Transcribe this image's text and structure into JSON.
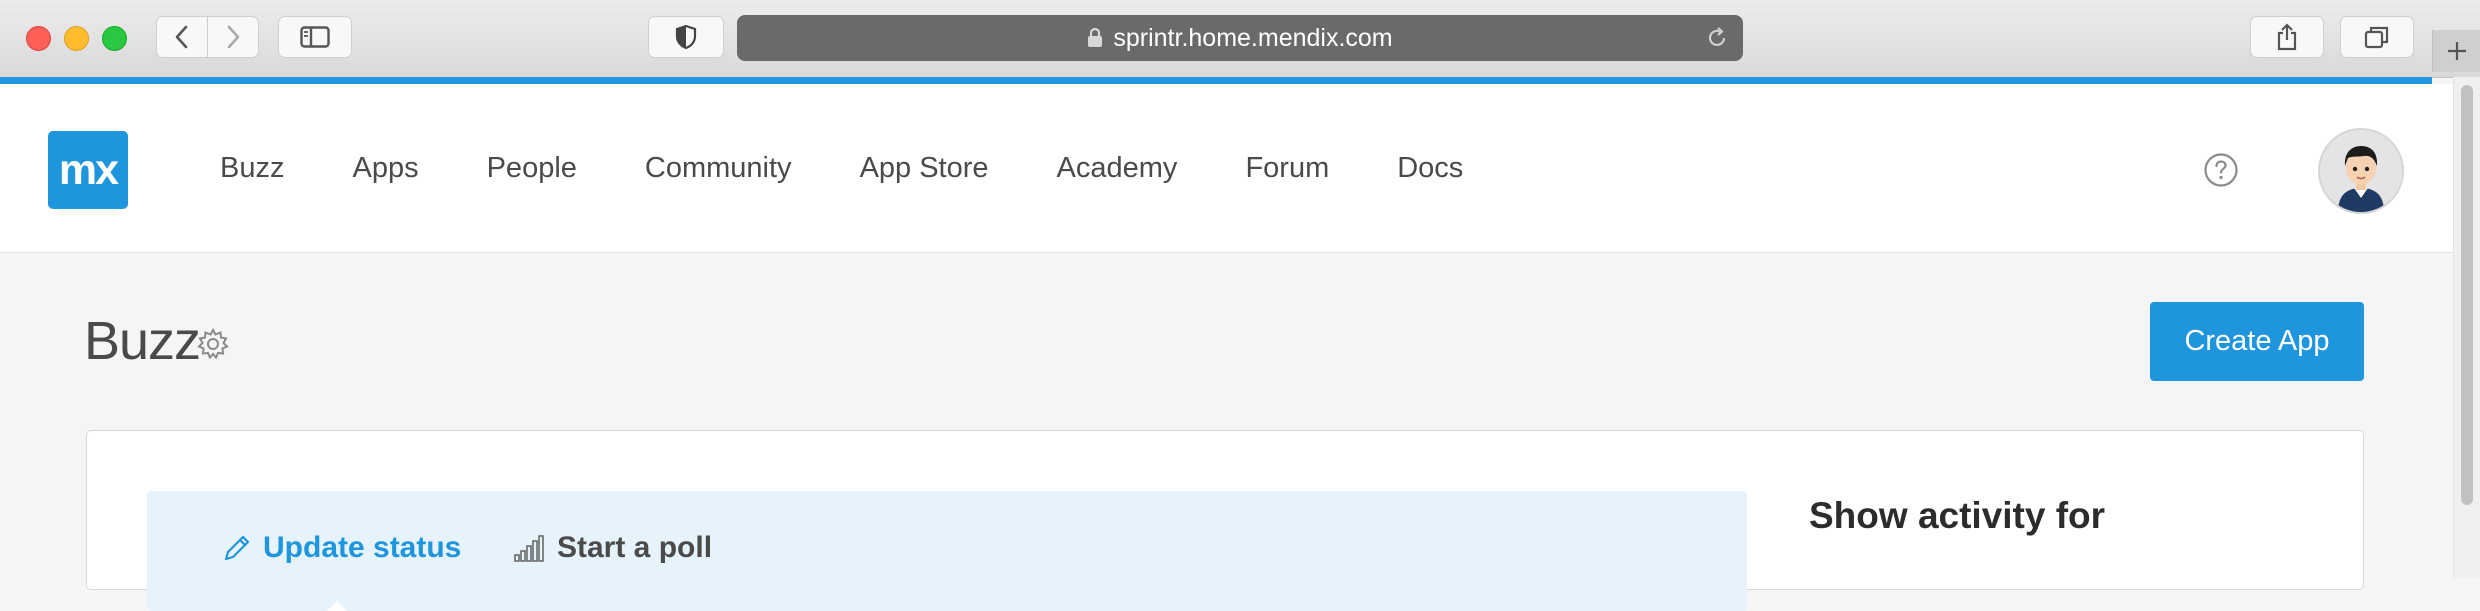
{
  "browser": {
    "url": "sprintr.home.mendix.com",
    "icons": [
      "back-icon",
      "forward-icon",
      "sidebar-icon",
      "shield-icon",
      "lock-icon",
      "reload-icon",
      "share-icon",
      "tabs-icon",
      "new-tab-icon"
    ]
  },
  "nav": {
    "logo_text": "mx",
    "items": [
      {
        "label": "Buzz"
      },
      {
        "label": "Apps"
      },
      {
        "label": "People"
      },
      {
        "label": "Community"
      },
      {
        "label": "App Store"
      },
      {
        "label": "Academy"
      },
      {
        "label": "Forum"
      },
      {
        "label": "Docs"
      }
    ],
    "help_icon": "question-circle-icon",
    "avatar_icon": "user-avatar"
  },
  "page": {
    "title": "Buzz",
    "settings_icon": "gear-icon",
    "create_button": "Create App"
  },
  "composer": {
    "update_status_label": "Update status",
    "start_poll_label": "Start a poll"
  },
  "activity": {
    "heading": "Show activity for"
  },
  "colors": {
    "accent": "#1e95dc",
    "accent_line": "#2196e0",
    "composer_bg": "#e6f3fb",
    "page_bg": "#f5f5f5"
  }
}
